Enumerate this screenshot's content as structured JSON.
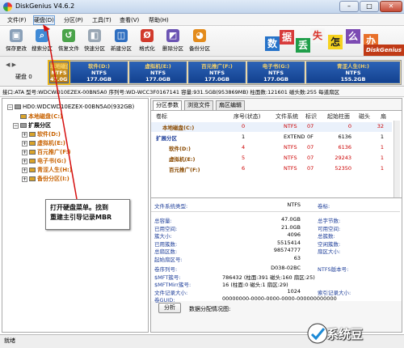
{
  "window": {
    "title": "DiskGenius V4.6.2",
    "minimize": "–",
    "maximize": "□",
    "close": "✕"
  },
  "menu": [
    "文件(F)",
    "硬盘(D)",
    "分区(P)",
    "工具(T)",
    "查看(V)",
    "帮助(H)"
  ],
  "toolbar": [
    {
      "label": "保存更改",
      "icon": "save-icon",
      "color": "#8aa0b8",
      "glyph": "▣"
    },
    {
      "label": "搜索分区",
      "icon": "search-icon",
      "color": "#3f8ad6",
      "glyph": "⌕"
    },
    {
      "label": "恢复文件",
      "icon": "recover-icon",
      "color": "#4aa34a",
      "glyph": "↺"
    },
    {
      "label": "快速分区",
      "icon": "quick-partition-icon",
      "color": "#9aa7b4",
      "glyph": "◧"
    },
    {
      "label": "新建分区",
      "icon": "new-partition-icon",
      "color": "#2f6fc1",
      "glyph": "◫"
    },
    {
      "label": "格式化",
      "icon": "format-icon",
      "color": "#d13a2c",
      "glyph": "Ø"
    },
    {
      "label": "删除分区",
      "icon": "delete-partition-icon",
      "color": "#6b53b3",
      "glyph": "◩"
    },
    {
      "label": "备份分区",
      "icon": "backup-icon",
      "color": "#e38b1c",
      "glyph": "◕"
    }
  ],
  "banner": {
    "chars": [
      {
        "t": "数",
        "bg": "#2673c9",
        "fg": "#fff"
      },
      {
        "t": "据",
        "bg": "#d83b3b",
        "fg": "#fff"
      },
      {
        "t": "丢",
        "bg": "#1f9e4a",
        "fg": "#fff"
      },
      {
        "t": "失",
        "bg": "#f5f5f5",
        "fg": "#d8332a"
      },
      {
        "t": "怎",
        "bg": "#f6d21f",
        "fg": "#222"
      },
      {
        "t": "么",
        "bg": "#7c4bb3",
        "fg": "#fff"
      },
      {
        "t": "办",
        "bg": "#e8702a",
        "fg": "#fff"
      }
    ],
    "brand": "DiskGenius"
  },
  "disk": {
    "label": "硬盘 0",
    "segments": [
      {
        "name": "本地磁盘(C:)",
        "fs": "NTFS",
        "size": "47.0GB",
        "first": true
      },
      {
        "name": "软件(D:)",
        "fs": "NTFS",
        "size": "177.0GB"
      },
      {
        "name": "虚拟机(E:)",
        "fs": "NTFS",
        "size": "177.0GB"
      },
      {
        "name": "百元推广(F:)",
        "fs": "NTFS",
        "size": "177.0GB"
      },
      {
        "name": "电子书(G:)",
        "fs": "NTFS",
        "size": "177.0GB"
      },
      {
        "name": "青涩人生(H:)",
        "fs": "NTFS",
        "size": "155.2GB"
      }
    ],
    "info": "接口:ATA  型号:WDCWD10EZEX-00BN5A0  序列号:WD-WCC3F0167141  容量:931.5GB(953869MB)  柱面数:121601  磁头数:255  每道扇区"
  },
  "tree": {
    "root": "HD0:WDCWD10EZEX-00BN5A0(932GB)",
    "c": "本地磁盘(C:)",
    "ext": "扩展分区",
    "children": [
      "软件(D:)",
      "虚拟机(E:)",
      "百元推广(F:)",
      "电子书(G:)",
      "青涩人生(H:)",
      "备份分区(I:)"
    ]
  },
  "callout": {
    "line1": "打开硬盘菜单。找到",
    "line2": "重建主引导记录MBR"
  },
  "tabs": [
    "分区参数",
    "浏览文件",
    "扇区编辑"
  ],
  "table": {
    "headers": [
      "卷标",
      "序号(状态)",
      "文件系统",
      "标识",
      "起始柱面",
      "磁头",
      "扇"
    ],
    "rows": [
      {
        "name": "本地磁盘(C:)",
        "num": "0",
        "fs": "NTFS",
        "id": "07",
        "cyl": "0",
        "head": "32",
        "red": true,
        "indent": 1
      },
      {
        "name": "扩展分区",
        "num": "1",
        "fs": "EXTEND",
        "id": "0F",
        "cyl": "6136",
        "head": "1",
        "red": false,
        "indent": 0
      },
      {
        "name": "软件(D:)",
        "num": "4",
        "fs": "NTFS",
        "id": "07",
        "cyl": "6136",
        "head": "1",
        "red": true,
        "indent": 2
      },
      {
        "name": "虚拟机(E:)",
        "num": "5",
        "fs": "NTFS",
        "id": "07",
        "cyl": "29243",
        "head": "1",
        "red": true,
        "indent": 2
      },
      {
        "name": "百元推广(F:)",
        "num": "6",
        "fs": "NTFS",
        "id": "07",
        "cyl": "52350",
        "head": "1",
        "red": true,
        "indent": 2
      }
    ]
  },
  "props": {
    "fs_type_label": "文件系统类型:",
    "fs_type": "NTFS",
    "vol_label": "卷标:",
    "rows": [
      {
        "l": "总容量:",
        "v": "47.0GB",
        "l2": "总字节数:",
        "v2": ""
      },
      {
        "l": "已用空间:",
        "v": "21.0GB",
        "l2": "可用空间:",
        "v2": ""
      },
      {
        "l": "簇大小:",
        "v": "4096",
        "l2": "总簇数:",
        "v2": ""
      },
      {
        "l": "已用簇数:",
        "v": "5515414",
        "l2": "空闲簇数:",
        "v2": ""
      },
      {
        "l": "总扇区数:",
        "v": "98574777",
        "l2": "扇区大小:",
        "v2": ""
      },
      {
        "l": "起始扇区号:",
        "v": "63",
        "l2": "",
        "v2": ""
      }
    ],
    "rows2": [
      {
        "l": "卷序列号:",
        "v": "D038-02BC",
        "l2": "NTFS版本号:",
        "v2": ""
      },
      {
        "l": "$MFT簇号:",
        "v": "786432 (柱面:391 磁头:160 扇区:25)",
        "l2": "",
        "v2": ""
      },
      {
        "l": "$MFTMirr簇号:",
        "v": "16 (柱面:0 磁头:1 扇区:29)",
        "l2": "",
        "v2": ""
      },
      {
        "l": "文件记录大小:",
        "v": "1024",
        "l2": "索引记录大小:",
        "v2": ""
      },
      {
        "l": "卷GUID:",
        "v": "00000000-0000-0000-0000-000000000000",
        "l2": "",
        "v2": ""
      }
    ],
    "analyze_button": "分析",
    "analyze_text": "数据分配情况图:"
  },
  "status": "就绪",
  "watermark": "系统豆"
}
